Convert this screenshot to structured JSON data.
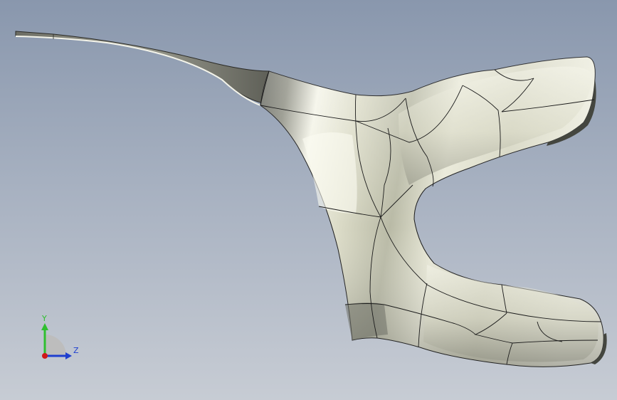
{
  "viewport": {
    "background_top": "#8997ad",
    "background_bottom": "#c7ccd4",
    "model": {
      "shape": "curved-y-shaped-surface",
      "surface_color": "#e6e6d4",
      "shade_color": "#5d5f57",
      "edge_color": "#1a1a1a"
    }
  },
  "triad": {
    "y_label": "Y",
    "z_label": "Z",
    "y_color": "#2fbf2f",
    "z_color": "#1f3fcf",
    "x_color": "#d01818"
  }
}
